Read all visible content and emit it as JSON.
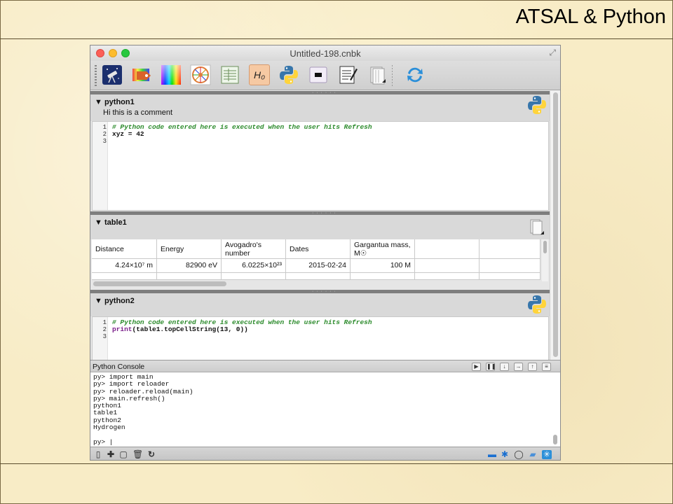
{
  "slide": {
    "title": "ATSAL & Python"
  },
  "window": {
    "title": "Untitled-198.cnbk",
    "fullscreen_glyph": "⤢"
  },
  "toolbar": {
    "items": [
      {
        "name": "telescope-icon"
      },
      {
        "name": "tag-icon"
      },
      {
        "name": "spectrum-icon"
      },
      {
        "name": "color-wheel-icon"
      },
      {
        "name": "table-icon"
      },
      {
        "name": "hubble-constant-icon",
        "label": "H₀"
      },
      {
        "name": "python-icon"
      },
      {
        "name": "display-icon"
      },
      {
        "name": "notebook-icon"
      },
      {
        "name": "stack-icon"
      },
      {
        "name": "refresh-icon"
      }
    ]
  },
  "cells": {
    "python1": {
      "name": "▼ python1",
      "comment": "Hi this is a comment",
      "lines": [
        "1",
        "2",
        "3"
      ],
      "code1": "# Python code entered here is executed when the user hits Refresh",
      "code2": "xyz = 42"
    },
    "table1": {
      "name": "▼ table1",
      "headers": [
        "Distance",
        "Energy",
        "Avogadro's\nnumber",
        "Dates",
        "Gargantua mass,\nM☉"
      ],
      "row": [
        "4.24×10⁷ m",
        "82900 eV",
        "6.0225×10²³",
        "2015-02-24",
        "100 M"
      ]
    },
    "python2": {
      "name": "▼ python2",
      "lines": [
        "1",
        "2",
        "3"
      ],
      "code1": "# Python code entered here is executed when the user hits Refresh",
      "code2_print": "print",
      "code2_rest": "(table1.topCellString(13, 0))"
    }
  },
  "console": {
    "title": "Python Console",
    "text": "py> import main\npy> import reloader\npy> reloader.reload(main)\npy> main.refresh()\npython1\ntable1\npython2\nHydrogen\n\npy> |"
  },
  "colors": {
    "comment_green": "#2a8a2a",
    "print_purple": "#7a1f8a",
    "python_blue": "#3776ab",
    "python_yellow": "#ffd43b"
  }
}
